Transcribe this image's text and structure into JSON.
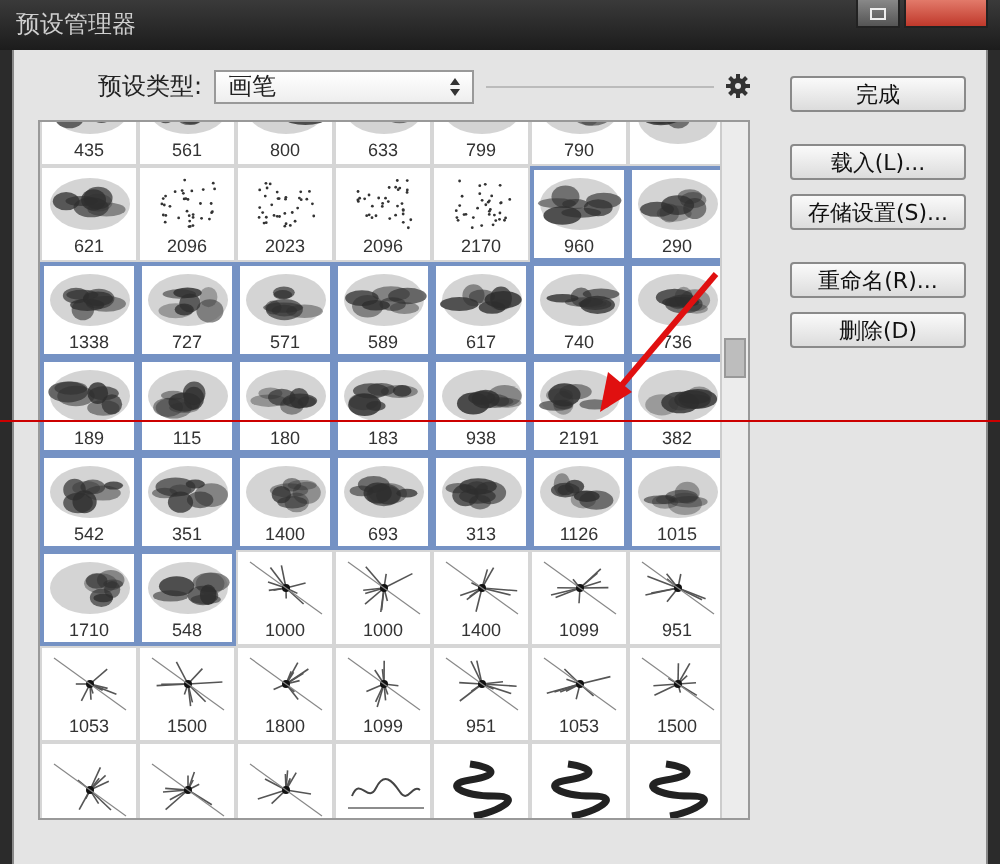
{
  "window": {
    "title": "预设管理器"
  },
  "preset_type": {
    "label": "预设类型:",
    "value": "画笔"
  },
  "brushes": [
    [
      {
        "label": "435",
        "selected": false,
        "kind": "ink"
      },
      {
        "label": "561",
        "selected": false,
        "kind": "ink"
      },
      {
        "label": "800",
        "selected": false,
        "kind": "ink"
      },
      {
        "label": "633",
        "selected": false,
        "kind": "ink"
      },
      {
        "label": "799",
        "selected": false,
        "kind": "ink"
      },
      {
        "label": "790",
        "selected": false,
        "kind": "ink"
      },
      {
        "selected": false,
        "kind": "ink"
      }
    ],
    [
      {
        "label": "621",
        "selected": false,
        "kind": "ink"
      },
      {
        "label": "2096",
        "selected": false,
        "kind": "dots"
      },
      {
        "label": "2023",
        "selected": false,
        "kind": "dots"
      },
      {
        "label": "2096",
        "selected": false,
        "kind": "dots"
      },
      {
        "label": "2170",
        "selected": false,
        "kind": "dots"
      },
      {
        "label": "960",
        "selected": true,
        "kind": "ink"
      },
      {
        "label": "290",
        "selected": true,
        "kind": "ink"
      }
    ],
    [
      {
        "label": "1338",
        "selected": true,
        "kind": "ink"
      },
      {
        "label": "727",
        "selected": true,
        "kind": "ink"
      },
      {
        "label": "571",
        "selected": true,
        "kind": "ink"
      },
      {
        "label": "589",
        "selected": true,
        "kind": "ink"
      },
      {
        "label": "617",
        "selected": true,
        "kind": "ink"
      },
      {
        "label": "740",
        "selected": true,
        "kind": "ink"
      },
      {
        "label": "736",
        "selected": true,
        "kind": "ink"
      }
    ],
    [
      {
        "label": "189",
        "selected": true,
        "kind": "ink"
      },
      {
        "label": "115",
        "selected": true,
        "kind": "ink"
      },
      {
        "label": "180",
        "selected": true,
        "kind": "ink"
      },
      {
        "label": "183",
        "selected": true,
        "kind": "ink"
      },
      {
        "label": "938",
        "selected": true,
        "kind": "ink"
      },
      {
        "label": "2191",
        "selected": true,
        "kind": "ink"
      },
      {
        "label": "382",
        "selected": true,
        "kind": "ink"
      }
    ],
    [
      {
        "label": "542",
        "selected": true,
        "kind": "ink"
      },
      {
        "label": "351",
        "selected": true,
        "kind": "ink"
      },
      {
        "label": "1400",
        "selected": true,
        "kind": "ink"
      },
      {
        "label": "693",
        "selected": true,
        "kind": "ink"
      },
      {
        "label": "313",
        "selected": true,
        "kind": "ink"
      },
      {
        "label": "1126",
        "selected": true,
        "kind": "ink"
      },
      {
        "label": "1015",
        "selected": true,
        "kind": "ink"
      }
    ],
    [
      {
        "label": "1710",
        "selected": true,
        "kind": "ink"
      },
      {
        "label": "548",
        "selected": true,
        "kind": "ink"
      },
      {
        "label": "1000",
        "selected": false,
        "kind": "burst"
      },
      {
        "label": "1000",
        "selected": false,
        "kind": "burst"
      },
      {
        "label": "1400",
        "selected": false,
        "kind": "burst"
      },
      {
        "label": "1099",
        "selected": false,
        "kind": "burst"
      },
      {
        "label": "951",
        "selected": false,
        "kind": "burst"
      }
    ],
    [
      {
        "label": "1053",
        "selected": false,
        "kind": "burst"
      },
      {
        "label": "1500",
        "selected": false,
        "kind": "burst"
      },
      {
        "label": "1800",
        "selected": false,
        "kind": "burst"
      },
      {
        "label": "1099",
        "selected": false,
        "kind": "burst"
      },
      {
        "label": "951",
        "selected": false,
        "kind": "burst"
      },
      {
        "label": "1053",
        "selected": false,
        "kind": "burst"
      },
      {
        "label": "1500",
        "selected": false,
        "kind": "burst"
      }
    ],
    [
      {
        "selected": false,
        "kind": "burst"
      },
      {
        "selected": false,
        "kind": "burst"
      },
      {
        "selected": false,
        "kind": "burst"
      },
      {
        "selected": false,
        "kind": "script"
      },
      {
        "selected": false,
        "kind": "swirl"
      },
      {
        "selected": false,
        "kind": "swirl"
      },
      {
        "selected": false,
        "kind": "swirl"
      }
    ]
  ],
  "button_groups": [
    [
      "完成"
    ],
    [
      "载入(L)...",
      "存储设置(S)..."
    ],
    [
      "重命名(R)...",
      "删除(D)"
    ]
  ]
}
